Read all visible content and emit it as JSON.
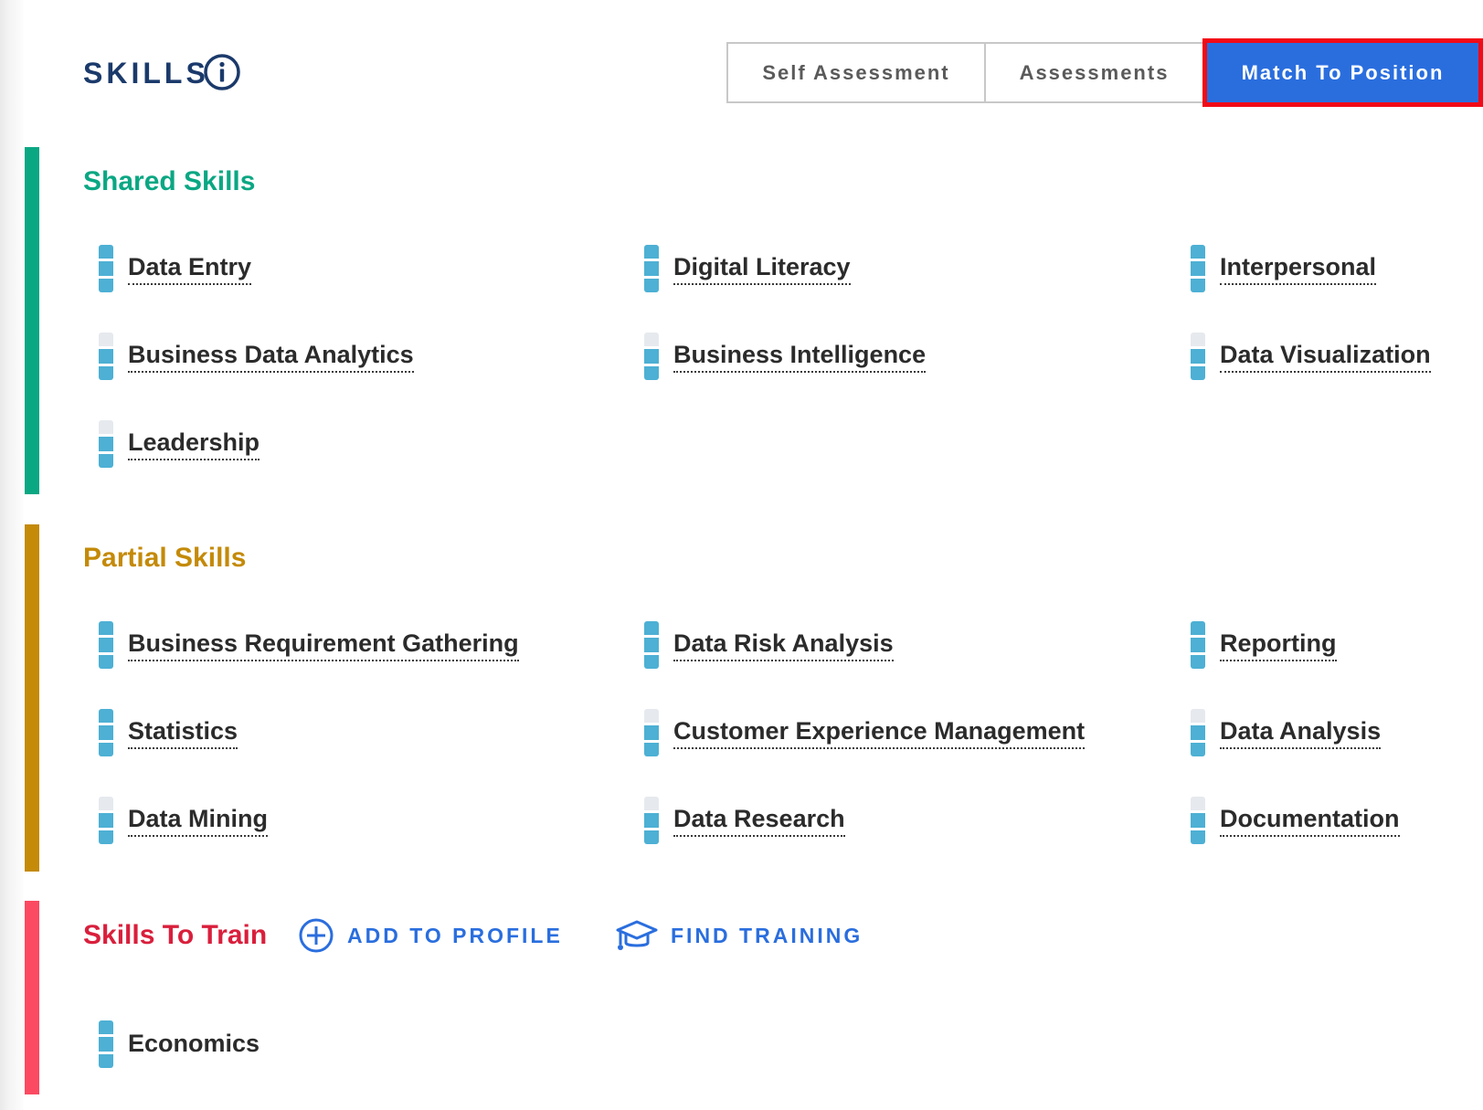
{
  "header": {
    "title": "SKILLS"
  },
  "toggle": {
    "self_assessment": "Self Assessment",
    "assessments": "Assessments",
    "match_to_position": "Match To Position"
  },
  "colors": {
    "shared": "#0aa783",
    "partial": "#c48a08",
    "train": "#d91f3c",
    "train_bar": "#fb4a61",
    "accent": "#2a6ede",
    "level_fill": "#4db0d4",
    "level_empty": "#e6e9ee"
  },
  "sections": {
    "shared": {
      "title": "Shared Skills",
      "skills": [
        {
          "label": "Data Entry",
          "level": 3
        },
        {
          "label": "Digital Literacy",
          "level": 3
        },
        {
          "label": "Interpersonal",
          "level": 3
        },
        {
          "label": "Business Data Analytics",
          "level": 2
        },
        {
          "label": "Business Intelligence",
          "level": 2
        },
        {
          "label": "Data Visualization",
          "level": 2
        },
        {
          "label": "Leadership",
          "level": 2
        }
      ]
    },
    "partial": {
      "title": "Partial Skills",
      "skills": [
        {
          "label": "Business Requirement Gathering",
          "level": 3
        },
        {
          "label": "Data Risk Analysis",
          "level": 3
        },
        {
          "label": "Reporting",
          "level": 3
        },
        {
          "label": "Statistics",
          "level": 3
        },
        {
          "label": "Customer Experience Management",
          "level": 2
        },
        {
          "label": "Data Analysis",
          "level": 2
        },
        {
          "label": "Data Mining",
          "level": 2
        },
        {
          "label": "Data Research",
          "level": 2
        },
        {
          "label": "Documentation",
          "level": 2
        }
      ]
    },
    "train": {
      "title": "Skills To Train",
      "add_to_profile": "ADD TO PROFILE",
      "find_training": "FIND TRAINING",
      "skills": [
        {
          "label": "Economics",
          "level": 3
        }
      ]
    }
  }
}
